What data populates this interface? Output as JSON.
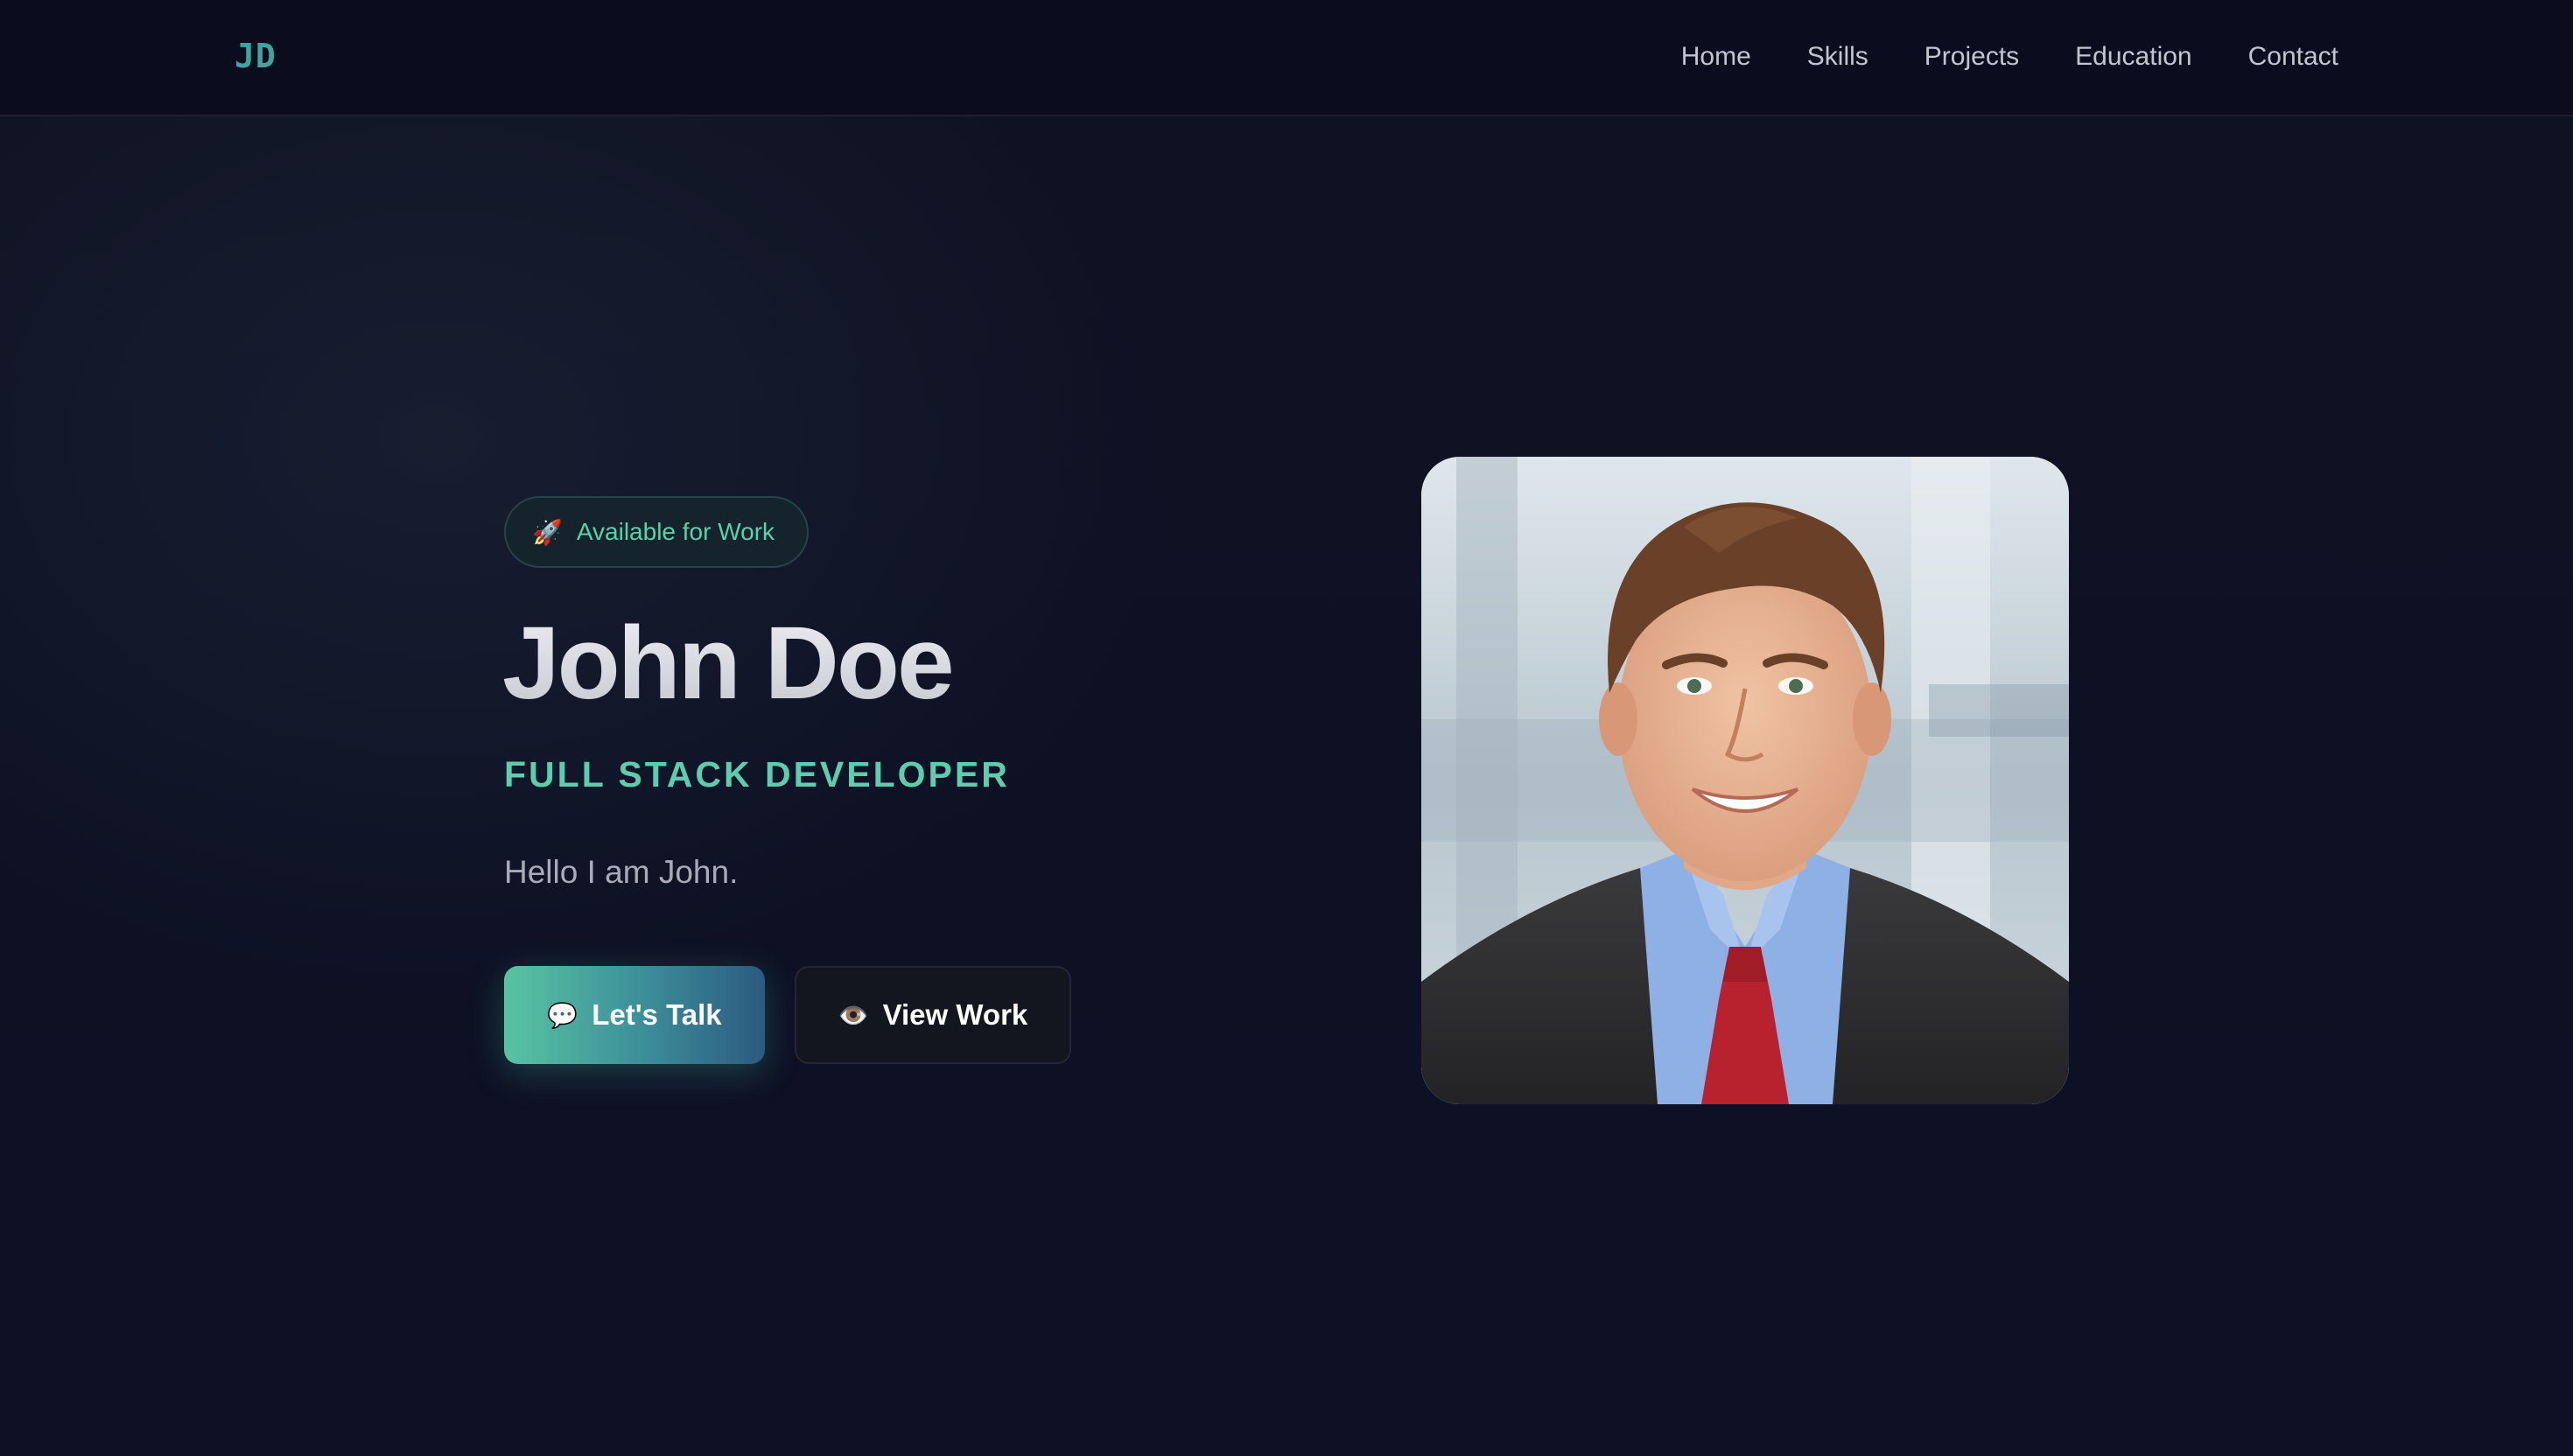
{
  "nav": {
    "logo": "JD",
    "links": [
      "Home",
      "Skills",
      "Projects",
      "Education",
      "Contact"
    ]
  },
  "hero": {
    "badge_icon": "rocket-icon",
    "badge_text": "Available for Work",
    "name": "John Doe",
    "role": "FULL STACK DEVELOPER",
    "tagline": "Hello I am John.",
    "primary_button": {
      "icon": "speech-bubble-icon",
      "label": "Let's Talk"
    },
    "secondary_button": {
      "icon": "eye-icon",
      "label": "View Work"
    }
  },
  "colors": {
    "background": "#0d0f20",
    "accent": "#5ccdae",
    "gradient_end": "#2c5a80"
  }
}
